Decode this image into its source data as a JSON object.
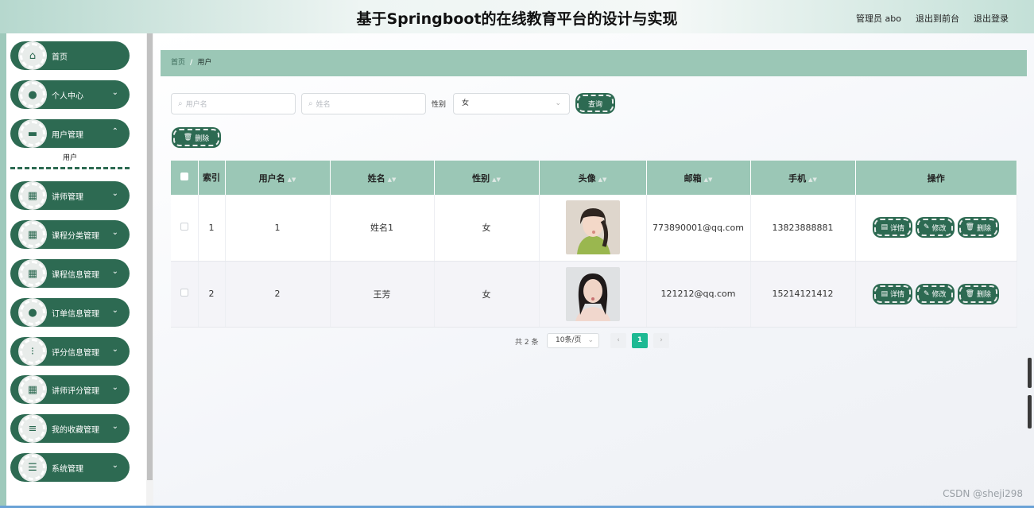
{
  "header": {
    "title": "基于Springboot的在线教育平台的设计与实现",
    "user": "管理员 abo",
    "to_front": "退出到前台",
    "logout": "退出登录"
  },
  "sidebar": {
    "items": [
      {
        "label": "首页",
        "icon": "home-icon"
      },
      {
        "label": "个人中心",
        "icon": "person-icon"
      },
      {
        "label": "用户管理",
        "icon": "monitor-icon"
      },
      {
        "label": "讲师管理",
        "icon": "grid-icon"
      },
      {
        "label": "课程分类管理",
        "icon": "grid-icon"
      },
      {
        "label": "课程信息管理",
        "icon": "grid-icon"
      },
      {
        "label": "订单信息管理",
        "icon": "person-icon"
      },
      {
        "label": "评分信息管理",
        "icon": "apps-icon"
      },
      {
        "label": "讲师评分管理",
        "icon": "grid-icon"
      },
      {
        "label": "我的收藏管理",
        "icon": "list-icon"
      },
      {
        "label": "系统管理",
        "icon": "sliders-icon"
      }
    ],
    "submenu": "用户"
  },
  "breadcrumb": {
    "home": "首页",
    "sep": "/",
    "current": "用户"
  },
  "search": {
    "username_placeholder": "用户名",
    "name_placeholder": "姓名",
    "gender_label": "性别",
    "gender_value": "女",
    "query_button": "查询"
  },
  "actions": {
    "delete_button": "删除"
  },
  "table": {
    "headers": [
      "索引",
      "用户名",
      "姓名",
      "性别",
      "头像",
      "邮箱",
      "手机",
      "操作"
    ],
    "rows": [
      {
        "index": "1",
        "username": "1",
        "name": "姓名1",
        "gender": "女",
        "email": "773890001@qq.com",
        "phone": "13823888881"
      },
      {
        "index": "2",
        "username": "2",
        "name": "王芳",
        "gender": "女",
        "email": "121212@qq.com",
        "phone": "15214121412"
      }
    ],
    "ops": {
      "detail": "详情",
      "edit": "修改",
      "delete": "删除"
    }
  },
  "pagination": {
    "total": "共 2 条",
    "page_size": "10条/页",
    "current_page": "1"
  },
  "watermark": "CSDN @sheji298",
  "colors": {
    "primary": "#2d6a52",
    "header_row": "#9bc7b6",
    "active_page": "#1db993"
  }
}
